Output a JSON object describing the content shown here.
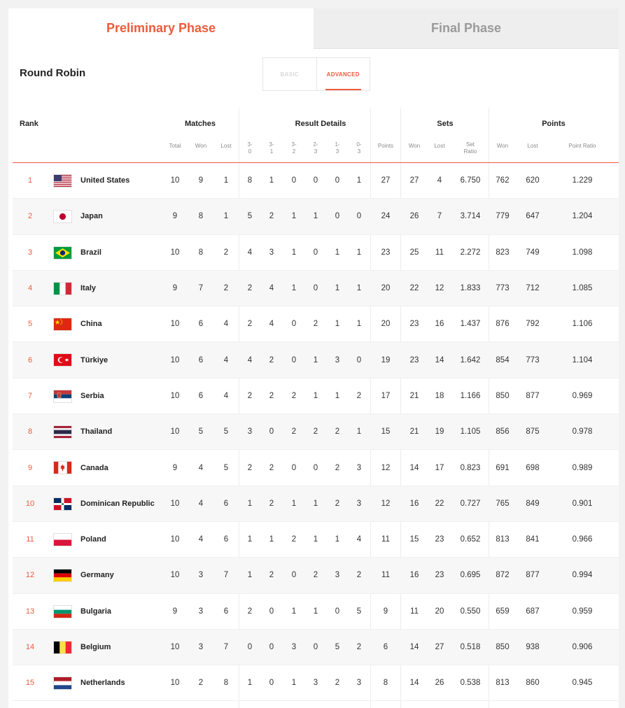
{
  "tabs": {
    "preliminary": "Preliminary Phase",
    "final": "Final Phase"
  },
  "section": {
    "title": "Round Robin"
  },
  "view_toggle": {
    "basic": "BASIC",
    "advanced": "ADVANCED"
  },
  "headers": {
    "rank": "Rank",
    "groups": {
      "matches": "Matches",
      "result_details": "Result Details",
      "sets": "Sets",
      "points": "Points"
    },
    "sub": {
      "total": "Total",
      "won": "Won",
      "lost": "Lost",
      "r30": "3-\n0",
      "r31": "3-\n1",
      "r32": "3-\n2",
      "r23": "2-\n3",
      "r13": "1-\n3",
      "r03": "0-\n3",
      "points": "Points",
      "sets_won": "Won",
      "sets_lost": "Lost",
      "set_ratio": "Set\nRatio",
      "points_won": "Won",
      "points_lost": "Lost",
      "point_ratio": "Point Ratio"
    }
  },
  "rows": [
    {
      "rank": "1",
      "flag": "us",
      "team": "United States",
      "total": "10",
      "won": "9",
      "lost": "1",
      "r30": "8",
      "r31": "1",
      "r32": "0",
      "r23": "0",
      "r13": "0",
      "r03": "1",
      "points": "27",
      "sw": "27",
      "sl": "4",
      "sr": "6.750",
      "pw": "762",
      "pl": "620",
      "pr": "1.229"
    },
    {
      "rank": "2",
      "flag": "jp",
      "team": "Japan",
      "total": "9",
      "won": "8",
      "lost": "1",
      "r30": "5",
      "r31": "2",
      "r32": "1",
      "r23": "1",
      "r13": "0",
      "r03": "0",
      "points": "24",
      "sw": "26",
      "sl": "7",
      "sr": "3.714",
      "pw": "779",
      "pl": "647",
      "pr": "1.204"
    },
    {
      "rank": "3",
      "flag": "br",
      "team": "Brazil",
      "total": "10",
      "won": "8",
      "lost": "2",
      "r30": "4",
      "r31": "3",
      "r32": "1",
      "r23": "0",
      "r13": "1",
      "r03": "1",
      "points": "23",
      "sw": "25",
      "sl": "11",
      "sr": "2.272",
      "pw": "823",
      "pl": "749",
      "pr": "1.098"
    },
    {
      "rank": "4",
      "flag": "it",
      "team": "Italy",
      "total": "9",
      "won": "7",
      "lost": "2",
      "r30": "2",
      "r31": "4",
      "r32": "1",
      "r23": "0",
      "r13": "1",
      "r03": "1",
      "points": "20",
      "sw": "22",
      "sl": "12",
      "sr": "1.833",
      "pw": "773",
      "pl": "712",
      "pr": "1.085"
    },
    {
      "rank": "5",
      "flag": "cn",
      "team": "China",
      "total": "10",
      "won": "6",
      "lost": "4",
      "r30": "2",
      "r31": "4",
      "r32": "0",
      "r23": "2",
      "r13": "1",
      "r03": "1",
      "points": "20",
      "sw": "23",
      "sl": "16",
      "sr": "1.437",
      "pw": "876",
      "pl": "792",
      "pr": "1.106"
    },
    {
      "rank": "6",
      "flag": "tr",
      "team": "Türkiye",
      "total": "10",
      "won": "6",
      "lost": "4",
      "r30": "4",
      "r31": "2",
      "r32": "0",
      "r23": "1",
      "r13": "3",
      "r03": "0",
      "points": "19",
      "sw": "23",
      "sl": "14",
      "sr": "1.642",
      "pw": "854",
      "pl": "773",
      "pr": "1.104"
    },
    {
      "rank": "7",
      "flag": "rs",
      "team": "Serbia",
      "total": "10",
      "won": "6",
      "lost": "4",
      "r30": "2",
      "r31": "2",
      "r32": "2",
      "r23": "1",
      "r13": "1",
      "r03": "2",
      "points": "17",
      "sw": "21",
      "sl": "18",
      "sr": "1.166",
      "pw": "850",
      "pl": "877",
      "pr": "0.969"
    },
    {
      "rank": "8",
      "flag": "th",
      "team": "Thailand",
      "total": "10",
      "won": "5",
      "lost": "5",
      "r30": "3",
      "r31": "0",
      "r32": "2",
      "r23": "2",
      "r13": "2",
      "r03": "1",
      "points": "15",
      "sw": "21",
      "sl": "19",
      "sr": "1.105",
      "pw": "856",
      "pl": "875",
      "pr": "0.978"
    },
    {
      "rank": "9",
      "flag": "ca",
      "team": "Canada",
      "total": "9",
      "won": "4",
      "lost": "5",
      "r30": "2",
      "r31": "2",
      "r32": "0",
      "r23": "0",
      "r13": "2",
      "r03": "3",
      "points": "12",
      "sw": "14",
      "sl": "17",
      "sr": "0.823",
      "pw": "691",
      "pl": "698",
      "pr": "0.989"
    },
    {
      "rank": "10",
      "flag": "do",
      "team": "Dominican Republic",
      "total": "10",
      "won": "4",
      "lost": "6",
      "r30": "1",
      "r31": "2",
      "r32": "1",
      "r23": "1",
      "r13": "2",
      "r03": "3",
      "points": "12",
      "sw": "16",
      "sl": "22",
      "sr": "0.727",
      "pw": "765",
      "pl": "849",
      "pr": "0.901"
    },
    {
      "rank": "11",
      "flag": "pl",
      "team": "Poland",
      "total": "10",
      "won": "4",
      "lost": "6",
      "r30": "1",
      "r31": "1",
      "r32": "2",
      "r23": "1",
      "r13": "1",
      "r03": "4",
      "points": "11",
      "sw": "15",
      "sl": "23",
      "sr": "0.652",
      "pw": "813",
      "pl": "841",
      "pr": "0.966"
    },
    {
      "rank": "12",
      "flag": "de",
      "team": "Germany",
      "total": "10",
      "won": "3",
      "lost": "7",
      "r30": "1",
      "r31": "2",
      "r32": "0",
      "r23": "2",
      "r13": "3",
      "r03": "2",
      "points": "11",
      "sw": "16",
      "sl": "23",
      "sr": "0.695",
      "pw": "872",
      "pl": "877",
      "pr": "0.994"
    },
    {
      "rank": "13",
      "flag": "bg",
      "team": "Bulgaria",
      "total": "9",
      "won": "3",
      "lost": "6",
      "r30": "2",
      "r31": "0",
      "r32": "1",
      "r23": "1",
      "r13": "0",
      "r03": "5",
      "points": "9",
      "sw": "11",
      "sl": "20",
      "sr": "0.550",
      "pw": "659",
      "pl": "687",
      "pr": "0.959"
    },
    {
      "rank": "14",
      "flag": "be",
      "team": "Belgium",
      "total": "10",
      "won": "3",
      "lost": "7",
      "r30": "0",
      "r31": "0",
      "r32": "3",
      "r23": "0",
      "r13": "5",
      "r03": "2",
      "points": "6",
      "sw": "14",
      "sl": "27",
      "sr": "0.518",
      "pw": "850",
      "pl": "938",
      "pr": "0.906"
    },
    {
      "rank": "15",
      "flag": "nl",
      "team": "Netherlands",
      "total": "10",
      "won": "2",
      "lost": "8",
      "r30": "1",
      "r31": "0",
      "r32": "1",
      "r23": "3",
      "r13": "2",
      "r03": "3",
      "points": "8",
      "sw": "14",
      "sl": "26",
      "sr": "0.538",
      "pw": "813",
      "pl": "860",
      "pr": "0.945"
    }
  ]
}
